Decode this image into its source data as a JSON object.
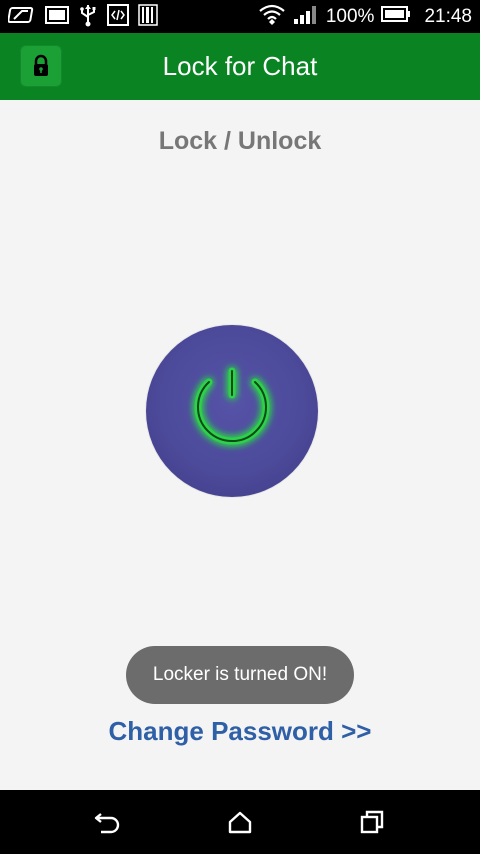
{
  "status_bar": {
    "icons_left": [
      "notification-icon",
      "gallery-icon",
      "usb-icon",
      "code-icon",
      "barcode-icon"
    ],
    "icons_right": [
      "wifi-icon",
      "signal-icon"
    ],
    "battery_percent": "100%",
    "time": "21:48"
  },
  "app_bar": {
    "icon": "lock-icon",
    "title": "Lock for Chat",
    "color": "#0a8422"
  },
  "main": {
    "heading": "Lock / Unlock",
    "power_button_icon": "power-icon",
    "power_state_color": "#36d94f",
    "toast": "Locker is turned ON!",
    "change_password_link": "Change Password >>"
  },
  "nav_bar": {
    "buttons": [
      "back-icon",
      "home-icon",
      "recents-icon"
    ]
  }
}
